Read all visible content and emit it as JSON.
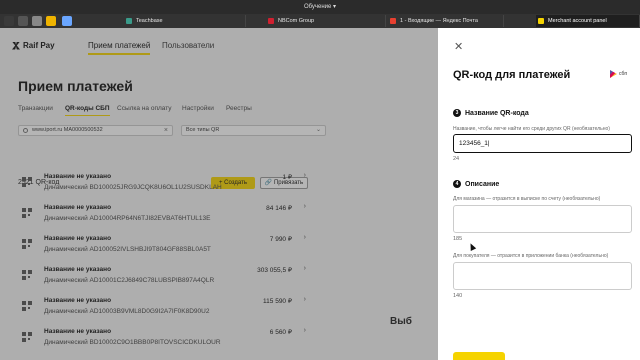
{
  "window": {
    "title": "Обучение ▾"
  },
  "tabs": [
    {
      "label": "",
      "color": "#3a3a3a"
    },
    {
      "label": "",
      "color": "#f0b400"
    },
    {
      "label": "",
      "color": "#888"
    },
    {
      "label": "",
      "color": "#ffd400"
    },
    {
      "label": "",
      "color": "#6aa6ff"
    },
    {
      "label": "Teachbase",
      "color": "#3a9b8a"
    },
    {
      "label": "NBCom Group",
      "color": "#d02030"
    },
    {
      "label": "1 - Входящие — Яндекс Почта",
      "color": "#e84030"
    },
    {
      "label": "Merchant account panel",
      "color": "#f5d300"
    }
  ],
  "header": {
    "brand": "Raif Pay",
    "nav": [
      "Прием платежей",
      "Пользователи"
    ]
  },
  "main": {
    "title": "Прием платежей",
    "subtabs": [
      "Транзакции",
      "QR-коды СБП",
      "Ссылка на оплату",
      "Настройки",
      "Реестры"
    ],
    "search_value": "www.iport.ru MA0000500532",
    "filter_value": "Все типы QR",
    "count": "2921 QR-код",
    "create_label": "+ Создать",
    "bind_label": "🔗 Привязать",
    "rows": [
      {
        "name": "Название не указано",
        "code": "Динамический BD100025JRG9JCQK8U6OL1U2SUSDKLAH",
        "amount": "1 ₽"
      },
      {
        "name": "Название не указано",
        "code": "Динамический AD10004RP64N6TJI82EVBAT6HTUL13E",
        "amount": "84 146 ₽"
      },
      {
        "name": "Название не указано",
        "code": "Динамический AD100052IVLSHBJI9T804GF88SBL0A5T",
        "amount": "7 990 ₽"
      },
      {
        "name": "Название не указано",
        "code": "Динамический AD10001C2J6849C78LUBSPIB897A4QLR",
        "amount": "303 055,5 ₽"
      },
      {
        "name": "Название не указано",
        "code": "Динамический AD10003B9VML8D0G9I2A7IF0K8D90U2",
        "amount": "115 590 ₽"
      },
      {
        "name": "Название не указано",
        "code": "Динамический BD10002C9O1BBB0P8ITOVSCICDKULOUR",
        "amount": "6 560 ₽"
      }
    ],
    "background_text": "Выб"
  },
  "drawer": {
    "title": "QR-код для платежей",
    "sbp_label": "сбп",
    "section3": {
      "num": "3",
      "title": "Название QR-кода",
      "hint": "Название, чтобы легче найти его среди других QR (необязательно)",
      "value": "123456_1",
      "counter": "24"
    },
    "section4": {
      "num": "4",
      "title": "Описание",
      "shop_hint": "Для магазина — отразится в выписке по счету (необязательно)",
      "shop_counter": "185",
      "buyer_hint": "Для покупателя — отразится в приложении банка (необязательно)",
      "buyer_counter": "140"
    }
  },
  "colors": {
    "accent": "#f5d300",
    "overlay": "#3c3c3c"
  }
}
